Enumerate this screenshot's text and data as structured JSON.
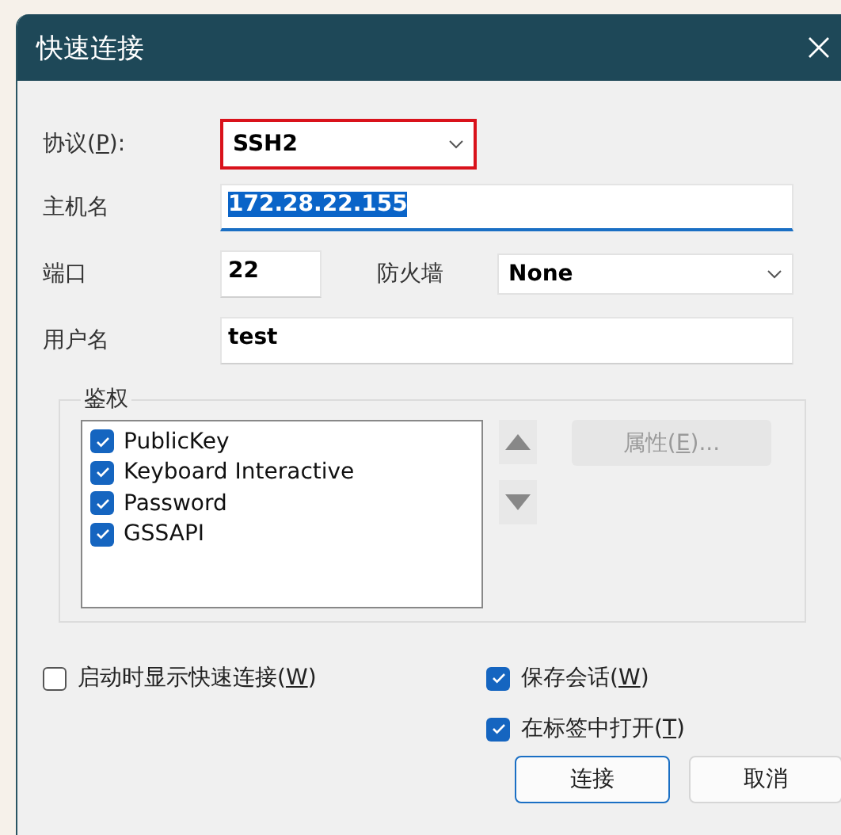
{
  "window": {
    "title": "快速连接"
  },
  "protocol": {
    "label": {
      "before": "协议(",
      "key": "P",
      "after": "):"
    },
    "value": "SSH2",
    "highlighted": true
  },
  "hostname": {
    "label": "主机名",
    "value": "172.28.22.155",
    "value_selected": true
  },
  "port": {
    "label": "端口",
    "value": "22"
  },
  "firewall": {
    "label": "防火墙",
    "value": "None"
  },
  "username": {
    "label": "用户名",
    "value": "test"
  },
  "auth": {
    "title": "鉴权",
    "methods": [
      {
        "label": "PublicKey",
        "checked": true
      },
      {
        "label": "Keyboard Interactive",
        "checked": true
      },
      {
        "label": "Password",
        "checked": true
      },
      {
        "label": "GSSAPI",
        "checked": true
      }
    ],
    "properties_button": {
      "label": {
        "before": "属性(",
        "key": "E",
        "after": ")..."
      },
      "disabled": true
    }
  },
  "options": {
    "left": [
      {
        "label": {
          "before": "启动时显示快速连接(",
          "key": "W",
          "after": ")"
        },
        "checked": false
      }
    ],
    "right": [
      {
        "label": {
          "before": "保存会话(",
          "key": "W",
          "after": ")"
        },
        "checked": true
      },
      {
        "label": {
          "before": "在标签中打开(",
          "key": "T",
          "after": ")"
        },
        "checked": true
      }
    ]
  },
  "buttons": [
    {
      "label": "连接",
      "default": true
    },
    {
      "label": "取消",
      "default": false
    }
  ]
}
